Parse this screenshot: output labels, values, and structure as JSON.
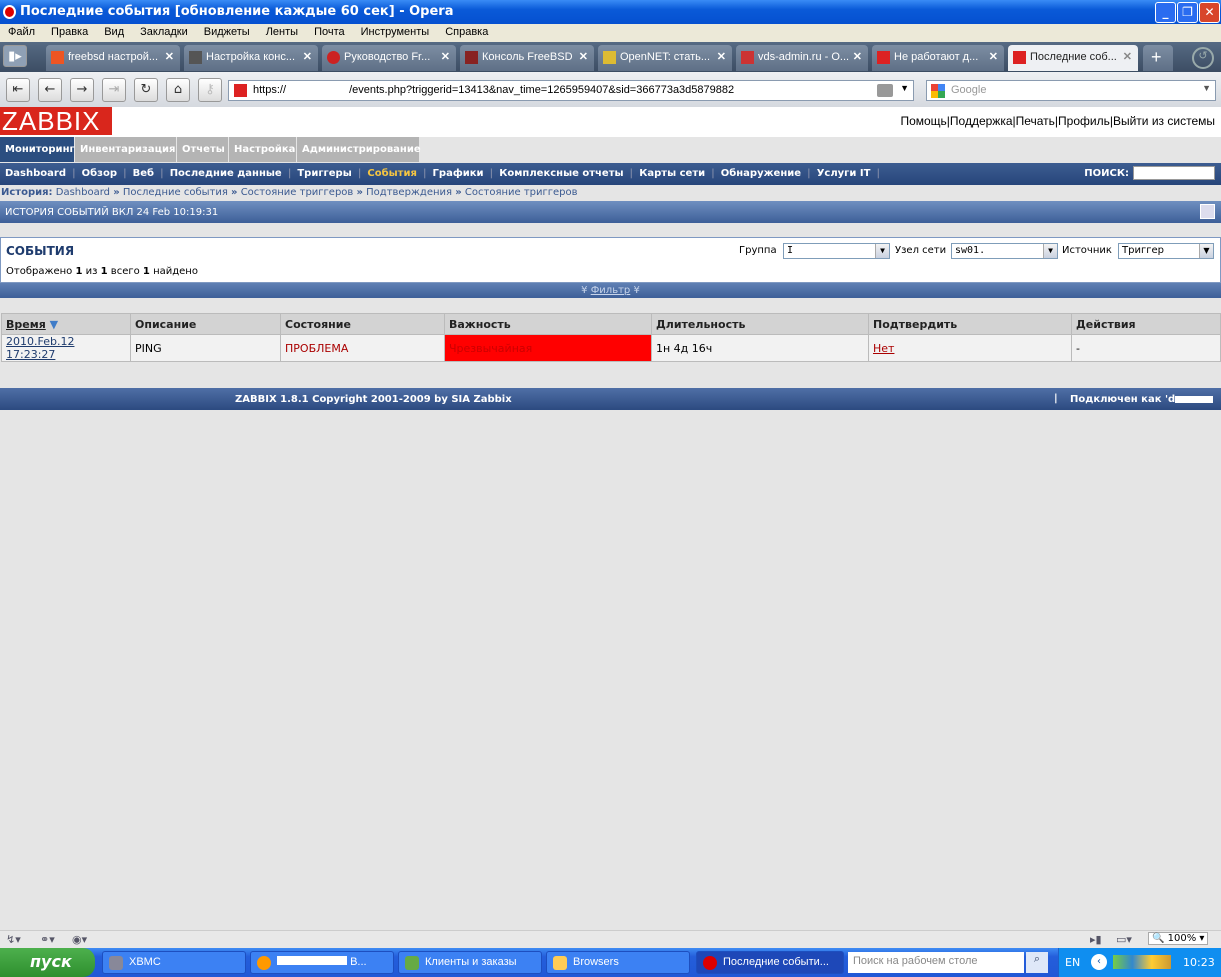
{
  "window": {
    "title": "Последние события [обновление каждые 60 сек] - Opera"
  },
  "menu": [
    "Файл",
    "Правка",
    "Вид",
    "Закладки",
    "Виджеты",
    "Ленты",
    "Почта",
    "Инструменты",
    "Справка"
  ],
  "tabs": [
    {
      "label": "freebsd настрой...",
      "color": "#e52"
    },
    {
      "label": "Настройка конс...",
      "color": "#555"
    },
    {
      "label": "Руководство Fr...",
      "color": "#c22"
    },
    {
      "label": "Консоль FreeBSD",
      "color": "#822"
    },
    {
      "label": "OpenNET: стать...",
      "color": "#db3"
    },
    {
      "label": "vds-admin.ru - O...",
      "color": "#c33"
    },
    {
      "label": "Не работают д...",
      "color": "#d22"
    },
    {
      "label": "Последние соб...",
      "color": "#d22"
    }
  ],
  "address": {
    "scheme": "https://",
    "path": "/events.php?triggerid=13413&nav_time=1265959407&sid=366773a3d5879882"
  },
  "search_placeholder": "Google",
  "logo": "ZABBIX",
  "toplinks": "Помощь|Поддержка|Печать|Профиль|Выйти из системы",
  "mainmenu": [
    "Мониторинг",
    "Инвентаризация",
    "Отчеты",
    "Настройка",
    "Администрирование"
  ],
  "submenu": [
    "Dashboard",
    "Обзор",
    "Веб",
    "Последние данные",
    "Триггеры",
    "События",
    "Графики",
    "Комплексные отчеты",
    "Карты сети",
    "Обнаружение",
    "Услуги IT"
  ],
  "search_label": "ПОИСК:",
  "history": {
    "label": "История:",
    "items": [
      "Dashboard",
      "Последние события",
      "Состояние триггеров",
      "Подтверждения",
      "Состояние триггеров"
    ]
  },
  "history_title": "ИСТОРИЯ СОБЫТИЙ ВКЛ 24 Feb 10:19:31",
  "events": {
    "title": "СОБЫТИЯ",
    "count_pre": "Отображено",
    "shown": "1",
    "of": "из",
    "total": "1",
    "all": "всего",
    "found": "1",
    "found_label": "найдено"
  },
  "filters": {
    "group_label": "Группа",
    "group_value": "I",
    "host_label": "Узел сети",
    "host_value": "sw01.",
    "source_label": "Источник",
    "source_value": "Триггер"
  },
  "filter_toggle": "Фильтр",
  "table": {
    "headers": [
      "Время",
      "Описание",
      "Состояние",
      "Важность",
      "Длительность",
      "Подтвердить",
      "Действия"
    ],
    "rows": [
      {
        "time": "2010.Feb.12 17:23:27",
        "desc": "PING",
        "state": "ПРОБЛЕМА",
        "severity": "Чрезвычайная",
        "duration": "1н 4д 16ч",
        "ack": "Нет",
        "actions": "-"
      }
    ]
  },
  "footer": {
    "copyright": "ZABBIX 1.8.1 Copyright 2001-2009 by SIA Zabbix",
    "connected": "Подключен как 'd."
  },
  "status": {
    "zoom": "100%"
  },
  "taskbar": {
    "start": "пуск",
    "items": [
      "XBMC",
      "B...",
      "Клиенты и заказы",
      "Browsers",
      "Последние событи..."
    ],
    "desk_search": "Поиск на рабочем столе",
    "lang": "EN",
    "clock": "10:23"
  },
  "colors": {
    "severity_disaster": "#ff0000",
    "problem": "#aa0000",
    "zabbix_red": "#d9261c"
  }
}
